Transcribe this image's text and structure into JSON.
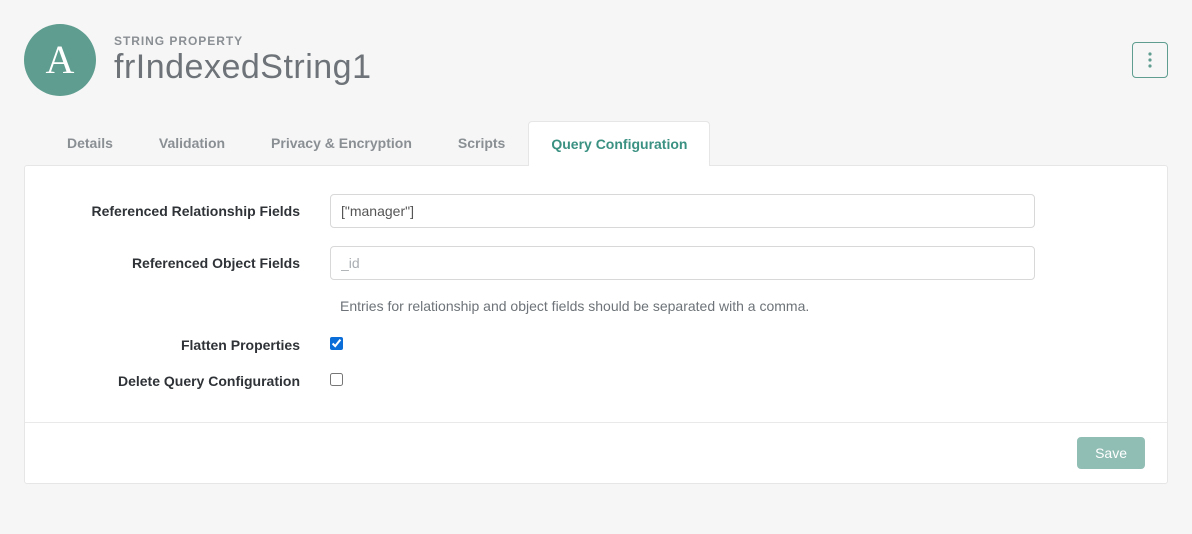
{
  "header": {
    "avatar_letter": "A",
    "overline": "STRING PROPERTY",
    "title": "frIndexedString1"
  },
  "tabs": [
    {
      "label": "Details",
      "active": false
    },
    {
      "label": "Validation",
      "active": false
    },
    {
      "label": "Privacy & Encryption",
      "active": false
    },
    {
      "label": "Scripts",
      "active": false
    },
    {
      "label": "Query Configuration",
      "active": true
    }
  ],
  "form": {
    "referenced_relationship_fields": {
      "label": "Referenced Relationship Fields",
      "value": "[\"manager\"]"
    },
    "referenced_object_fields": {
      "label": "Referenced Object Fields",
      "placeholder": "_id",
      "value": ""
    },
    "help_text": "Entries for relationship and object fields should be separated with a comma.",
    "flatten_properties": {
      "label": "Flatten Properties",
      "checked": true
    },
    "delete_query_config": {
      "label": "Delete Query Configuration",
      "checked": false
    }
  },
  "footer": {
    "save_label": "Save"
  }
}
